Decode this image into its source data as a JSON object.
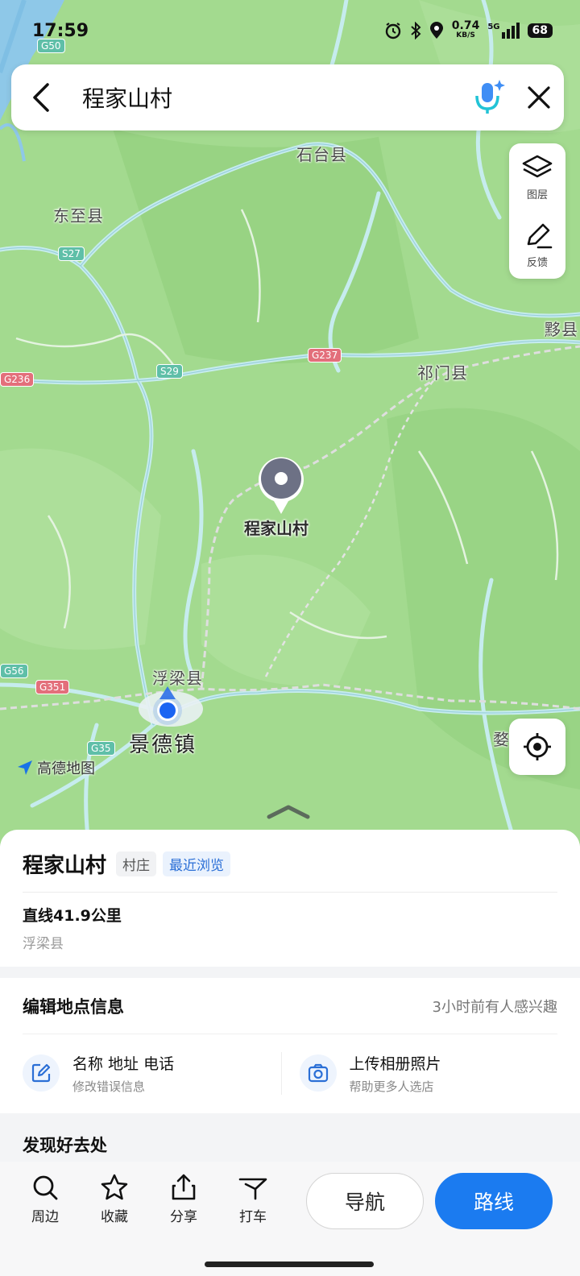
{
  "status_bar": {
    "time": "17:59",
    "speed_value": "0.74",
    "speed_unit": "KB/S",
    "network": "5G",
    "battery": "68",
    "icons": [
      "alarm-icon",
      "bluetooth-icon",
      "location-icon",
      "signal-icon",
      "battery-icon"
    ]
  },
  "search": {
    "query": "程家山村",
    "icons": [
      "back-arrow-icon",
      "voice-mic-icon",
      "close-icon"
    ]
  },
  "map_tools": {
    "layers_label": "图层",
    "feedback_label": "反馈"
  },
  "map": {
    "labels": {
      "shitai": "石台县",
      "dongzhi": "东至县",
      "yixian": "黟县",
      "qimen": "祁门县",
      "fuliang": "浮梁县",
      "jingdezhen": "景德镇",
      "wu": "婺"
    },
    "road_tags": {
      "g50": "G50",
      "s27": "S27",
      "g237": "G237",
      "s29": "S29",
      "g236": "G236",
      "g56": "G56",
      "g351": "G351",
      "g35": "G35"
    },
    "marker_label": "程家山村",
    "brand": "高德地图",
    "colors": {
      "land": "#9fd88b",
      "expressway": "#bfe6ea",
      "province_border": "#d9d9d9"
    }
  },
  "place": {
    "name": "程家山村",
    "type_tag": "村庄",
    "recent_tag": "最近浏览",
    "distance": "直线41.9公里",
    "county": "浮梁县"
  },
  "edit_info": {
    "title": "编辑地点信息",
    "hint": "3小时前有人感兴趣",
    "item1_title": "名称 地址 电话",
    "item1_sub": "修改错误信息",
    "item2_title": "上传相册照片",
    "item2_sub": "帮助更多人选店"
  },
  "discover_title": "发现好去处",
  "actions": {
    "nearby": "周边",
    "favorite": "收藏",
    "share": "分享",
    "taxi": "打车",
    "navigate": "导航",
    "route": "路线"
  }
}
